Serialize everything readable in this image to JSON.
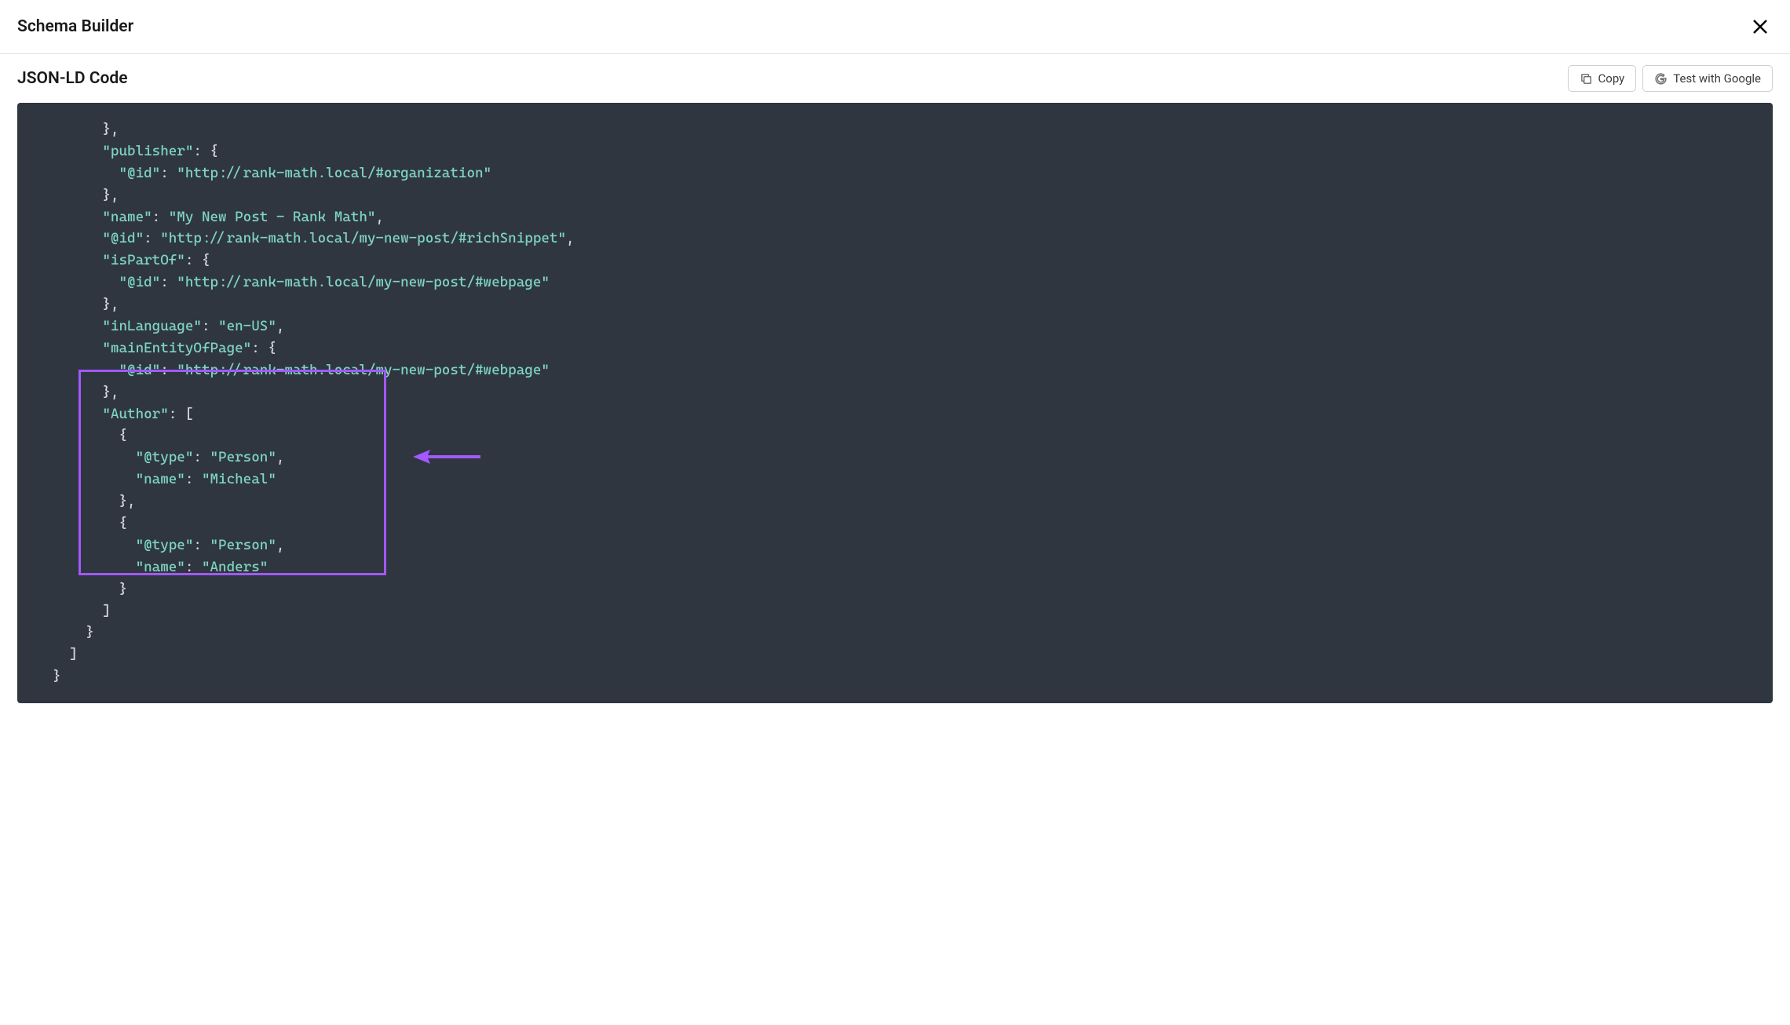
{
  "header": {
    "title": "Schema Builder"
  },
  "subheader": {
    "title": "JSON-LD Code"
  },
  "buttons": {
    "copy": "Copy",
    "test_google": "Test with Google"
  },
  "code": {
    "lines": [
      {
        "indent": 3,
        "tokens": [
          {
            "t": "punct",
            "v": "},"
          }
        ]
      },
      {
        "indent": 3,
        "tokens": [
          {
            "t": "key",
            "v": "\"publisher\""
          },
          {
            "t": "punct",
            "v": ": {"
          }
        ]
      },
      {
        "indent": 4,
        "tokens": [
          {
            "t": "key",
            "v": "\"@id\""
          },
          {
            "t": "punct",
            "v": ": "
          },
          {
            "t": "string",
            "v": "\"http://rank-math.local/#organization\""
          }
        ]
      },
      {
        "indent": 3,
        "tokens": [
          {
            "t": "punct",
            "v": "},"
          }
        ]
      },
      {
        "indent": 3,
        "tokens": [
          {
            "t": "key",
            "v": "\"name\""
          },
          {
            "t": "punct",
            "v": ": "
          },
          {
            "t": "string",
            "v": "\"My New Post - Rank Math\""
          },
          {
            "t": "punct",
            "v": ","
          }
        ]
      },
      {
        "indent": 3,
        "tokens": [
          {
            "t": "key",
            "v": "\"@id\""
          },
          {
            "t": "punct",
            "v": ": "
          },
          {
            "t": "string",
            "v": "\"http://rank-math.local/my-new-post/#richSnippet\""
          },
          {
            "t": "punct",
            "v": ","
          }
        ]
      },
      {
        "indent": 3,
        "tokens": [
          {
            "t": "key",
            "v": "\"isPartOf\""
          },
          {
            "t": "punct",
            "v": ": {"
          }
        ]
      },
      {
        "indent": 4,
        "tokens": [
          {
            "t": "key",
            "v": "\"@id\""
          },
          {
            "t": "punct",
            "v": ": "
          },
          {
            "t": "string",
            "v": "\"http://rank-math.local/my-new-post/#webpage\""
          }
        ]
      },
      {
        "indent": 3,
        "tokens": [
          {
            "t": "punct",
            "v": "},"
          }
        ]
      },
      {
        "indent": 3,
        "tokens": [
          {
            "t": "key",
            "v": "\"inLanguage\""
          },
          {
            "t": "punct",
            "v": ": "
          },
          {
            "t": "string",
            "v": "\"en-US\""
          },
          {
            "t": "punct",
            "v": ","
          }
        ]
      },
      {
        "indent": 3,
        "tokens": [
          {
            "t": "key",
            "v": "\"mainEntityOfPage\""
          },
          {
            "t": "punct",
            "v": ": {"
          }
        ]
      },
      {
        "indent": 4,
        "tokens": [
          {
            "t": "key",
            "v": "\"@id\""
          },
          {
            "t": "punct",
            "v": ": "
          },
          {
            "t": "string",
            "v": "\"http://rank-math.local/my-new-post/#webpage\""
          }
        ]
      },
      {
        "indent": 3,
        "tokens": [
          {
            "t": "punct",
            "v": "},"
          }
        ]
      },
      {
        "indent": 3,
        "tokens": [
          {
            "t": "key",
            "v": "\"Author\""
          },
          {
            "t": "punct",
            "v": ": ["
          }
        ]
      },
      {
        "indent": 4,
        "tokens": [
          {
            "t": "punct",
            "v": "{"
          }
        ]
      },
      {
        "indent": 5,
        "tokens": [
          {
            "t": "key",
            "v": "\"@type\""
          },
          {
            "t": "punct",
            "v": ": "
          },
          {
            "t": "string",
            "v": "\"Person\""
          },
          {
            "t": "punct",
            "v": ","
          }
        ]
      },
      {
        "indent": 5,
        "tokens": [
          {
            "t": "key",
            "v": "\"name\""
          },
          {
            "t": "punct",
            "v": ": "
          },
          {
            "t": "string",
            "v": "\"Micheal\""
          }
        ]
      },
      {
        "indent": 4,
        "tokens": [
          {
            "t": "punct",
            "v": "},"
          }
        ]
      },
      {
        "indent": 4,
        "tokens": [
          {
            "t": "punct",
            "v": "{"
          }
        ]
      },
      {
        "indent": 5,
        "tokens": [
          {
            "t": "key",
            "v": "\"@type\""
          },
          {
            "t": "punct",
            "v": ": "
          },
          {
            "t": "string",
            "v": "\"Person\""
          },
          {
            "t": "punct",
            "v": ","
          }
        ]
      },
      {
        "indent": 5,
        "tokens": [
          {
            "t": "key",
            "v": "\"name\""
          },
          {
            "t": "punct",
            "v": ": "
          },
          {
            "t": "string",
            "v": "\"Anders\""
          }
        ]
      },
      {
        "indent": 4,
        "tokens": [
          {
            "t": "punct",
            "v": "}"
          }
        ]
      },
      {
        "indent": 3,
        "tokens": [
          {
            "t": "punct",
            "v": "]"
          }
        ]
      },
      {
        "indent": 2,
        "tokens": [
          {
            "t": "punct",
            "v": "}"
          }
        ]
      },
      {
        "indent": 1,
        "tokens": [
          {
            "t": "punct",
            "v": "]"
          }
        ]
      },
      {
        "indent": 0,
        "tokens": [
          {
            "t": "punct",
            "v": "}"
          }
        ]
      }
    ]
  },
  "annotation": {
    "highlight_color": "#a259ff",
    "arrow_color": "#a259ff"
  }
}
